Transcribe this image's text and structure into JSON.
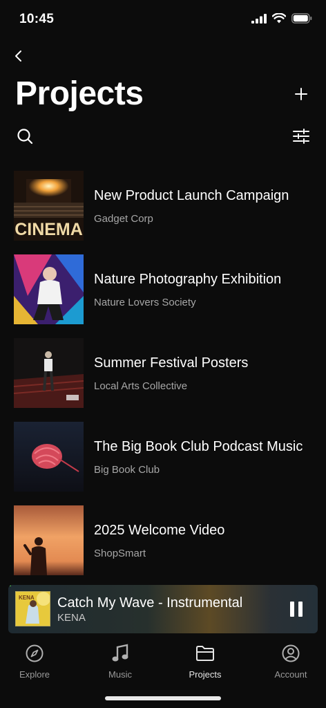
{
  "status_bar": {
    "time": "10:45"
  },
  "header": {
    "title": "Projects"
  },
  "projects": [
    {
      "title": "New Product Launch Campaign",
      "client": "Gadget Corp",
      "thumb_text": "CINEMA"
    },
    {
      "title": "Nature Photography Exhibition",
      "client": "Nature Lovers Society"
    },
    {
      "title": "Summer Festival Posters",
      "client": "Local Arts Collective"
    },
    {
      "title": "The Big Book Club Podcast Music",
      "client": "Big Book Club"
    },
    {
      "title": "2025 Welcome Video",
      "client": "ShopSmart"
    }
  ],
  "now_playing": {
    "title": "Catch My Wave - Instrumental",
    "artist": "KENA",
    "art_text": "KENA",
    "progress": 0.01
  },
  "tabs": [
    {
      "label": "Explore",
      "icon": "compass-icon",
      "active": false
    },
    {
      "label": "Music",
      "icon": "music-note-icon",
      "active": false
    },
    {
      "label": "Projects",
      "icon": "folder-icon",
      "active": true
    },
    {
      "label": "Account",
      "icon": "user-circle-icon",
      "active": false
    }
  ],
  "colors": {
    "background": "#0c0c0c",
    "accent_progress": "#4caf50",
    "muted_text": "#a7a7a7"
  }
}
